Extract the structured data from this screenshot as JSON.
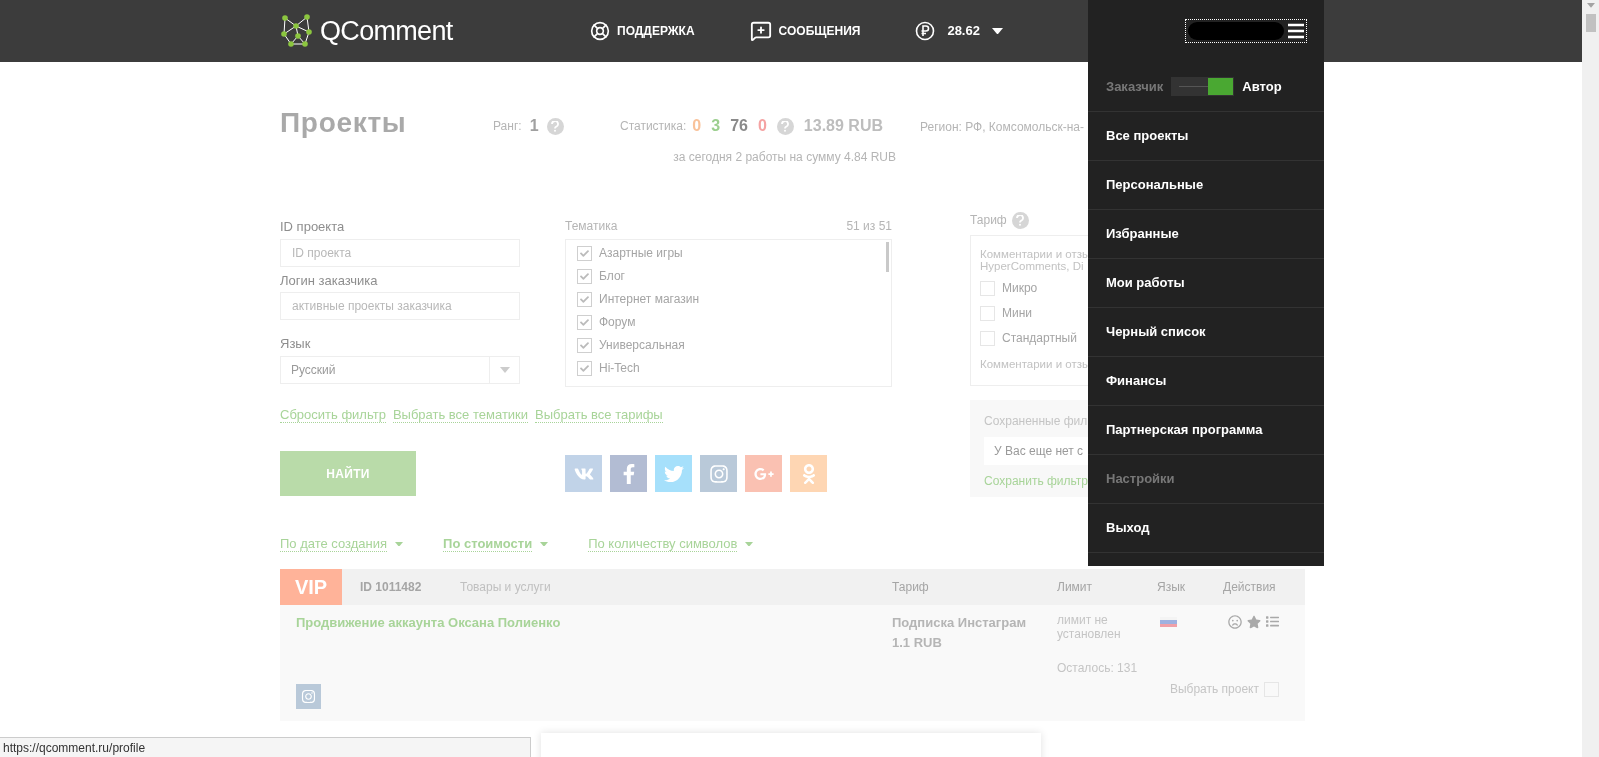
{
  "header": {
    "logo_text": "QComment",
    "nav": [
      {
        "kind": "support",
        "label": "ПОДДЕРЖКА"
      },
      {
        "kind": "messages",
        "label": "СООБЩЕНИЯ"
      }
    ],
    "balance": "28.62"
  },
  "page": {
    "title": "Проекты",
    "rank_label": "Ранг:",
    "rank": "1",
    "stats_label": "Статистика:",
    "stats": [
      {
        "value": "0",
        "color": "#f9c29a"
      },
      {
        "value": "3",
        "color": "#9ccf8f"
      },
      {
        "value": "76",
        "color": "#8a8a8a"
      },
      {
        "value": "0",
        "color": "#f5a3a3"
      }
    ],
    "stats_sum": "13.89 RUB",
    "today": "за сегодня 2 работы на сумму 4.84 RUB",
    "region": "Регион: РФ, Комсомольск-на-"
  },
  "filters": {
    "project_id": {
      "label": "ID проекта",
      "placeholder": "ID проекта"
    },
    "customer_login": {
      "label": "Логин заказчика",
      "placeholder": "активные проекты заказчика"
    },
    "language": {
      "label": "Язык",
      "value": "Русский"
    },
    "topics": {
      "label": "Тематика",
      "count": "51 из 51",
      "items": [
        {
          "label": "Азартные игры",
          "checked": true
        },
        {
          "label": "Блог",
          "checked": true
        },
        {
          "label": "Интернет магазин",
          "checked": true
        },
        {
          "label": "Форум",
          "checked": true
        },
        {
          "label": "Универсальная",
          "checked": true
        },
        {
          "label": "Hi-Tech",
          "checked": true
        }
      ]
    },
    "tariff": {
      "label": "Тариф",
      "group_title": "Комментарии и отзы",
      "group_subtitle": "HyperComments, Di",
      "items": [
        {
          "label": "Микро",
          "checked": false
        },
        {
          "label": "Мини",
          "checked": false
        },
        {
          "label": "Стандартный",
          "checked": false
        }
      ],
      "next_group_title": "Комментарии и отзы"
    },
    "links": [
      "Сбросить фильтр",
      "Выбрать все тематики",
      "Выбрать все тарифы"
    ],
    "find_button": "НАЙТИ",
    "socials": [
      {
        "kind": "vk"
      },
      {
        "kind": "facebook"
      },
      {
        "kind": "twitter"
      },
      {
        "kind": "instagram"
      },
      {
        "kind": "googleplus"
      },
      {
        "kind": "odnoklassniki"
      }
    ],
    "saved_filters": {
      "title": "Сохраненные фил",
      "value": "У Вас еще нет с",
      "save_link": "Сохранить фильтр"
    }
  },
  "sorts": [
    {
      "label": "По дате создания",
      "selected": false
    },
    {
      "label": "По стоимости",
      "selected": true
    },
    {
      "label": "По количеству символов",
      "selected": false
    }
  ],
  "table": {
    "badge": "VIP",
    "id": "ID 1011482",
    "category": "Товары и услуги",
    "columns": [
      "Тариф",
      "Лимит",
      "Язык",
      "Действия"
    ],
    "row": {
      "title": "Продвижение аккаунта Оксана Полиенко",
      "tariff": "Подписка Инстаграм",
      "price": "1.1 RUB",
      "limit": "лимит не установлен",
      "remaining": "Осталось: 131",
      "select_label": "Выбрать проект",
      "selected": false
    }
  },
  "menu": {
    "role_left": "Заказчик",
    "role_right": "Автор",
    "toggle_on": true,
    "items": [
      {
        "label": "Все проекты",
        "disabled": false
      },
      {
        "label": "Персональные",
        "disabled": false
      },
      {
        "label": "Избранные",
        "disabled": false
      },
      {
        "label": "Мои работы",
        "disabled": false
      },
      {
        "label": "Черный список",
        "disabled": false
      },
      {
        "label": "Финансы",
        "disabled": false
      },
      {
        "label": "Партнерская программа",
        "disabled": false
      },
      {
        "label": "Настройки",
        "disabled": true
      },
      {
        "label": "Выход",
        "disabled": false
      }
    ]
  },
  "status_url": "https://qcomment.ru/profile"
}
